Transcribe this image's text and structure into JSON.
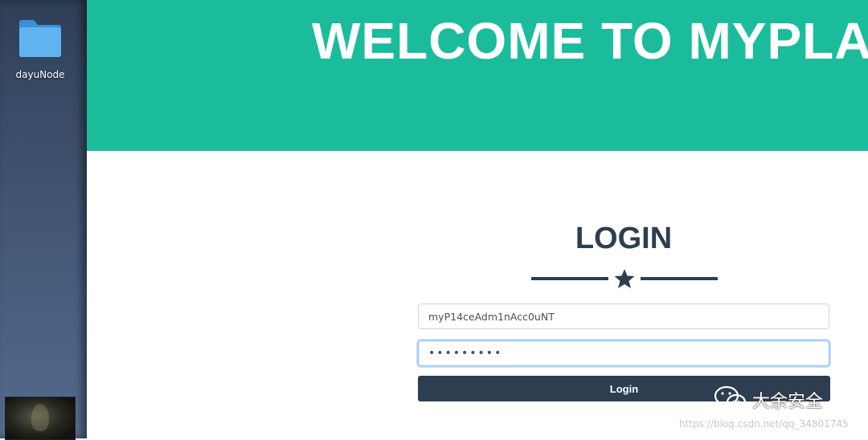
{
  "desktop": {
    "icons": [
      {
        "label": "dayuNode",
        "icon": "folder-icon"
      }
    ]
  },
  "page": {
    "hero_title": "WELCOME TO MYPLA",
    "login_heading": "LOGIN",
    "divider_icon": "star-icon",
    "username_value": "myP14ceAdm1nAcc0uNT",
    "password_value": "•••••••••",
    "login_button": "Login"
  },
  "watermark": {
    "brand": "大余安全",
    "brand_icon": "wechat-icon",
    "url": "https://blog.csdn.net/qq_34801745"
  },
  "colors": {
    "hero_bg": "#1abc9c",
    "primary_dark": "#2c3e50"
  }
}
